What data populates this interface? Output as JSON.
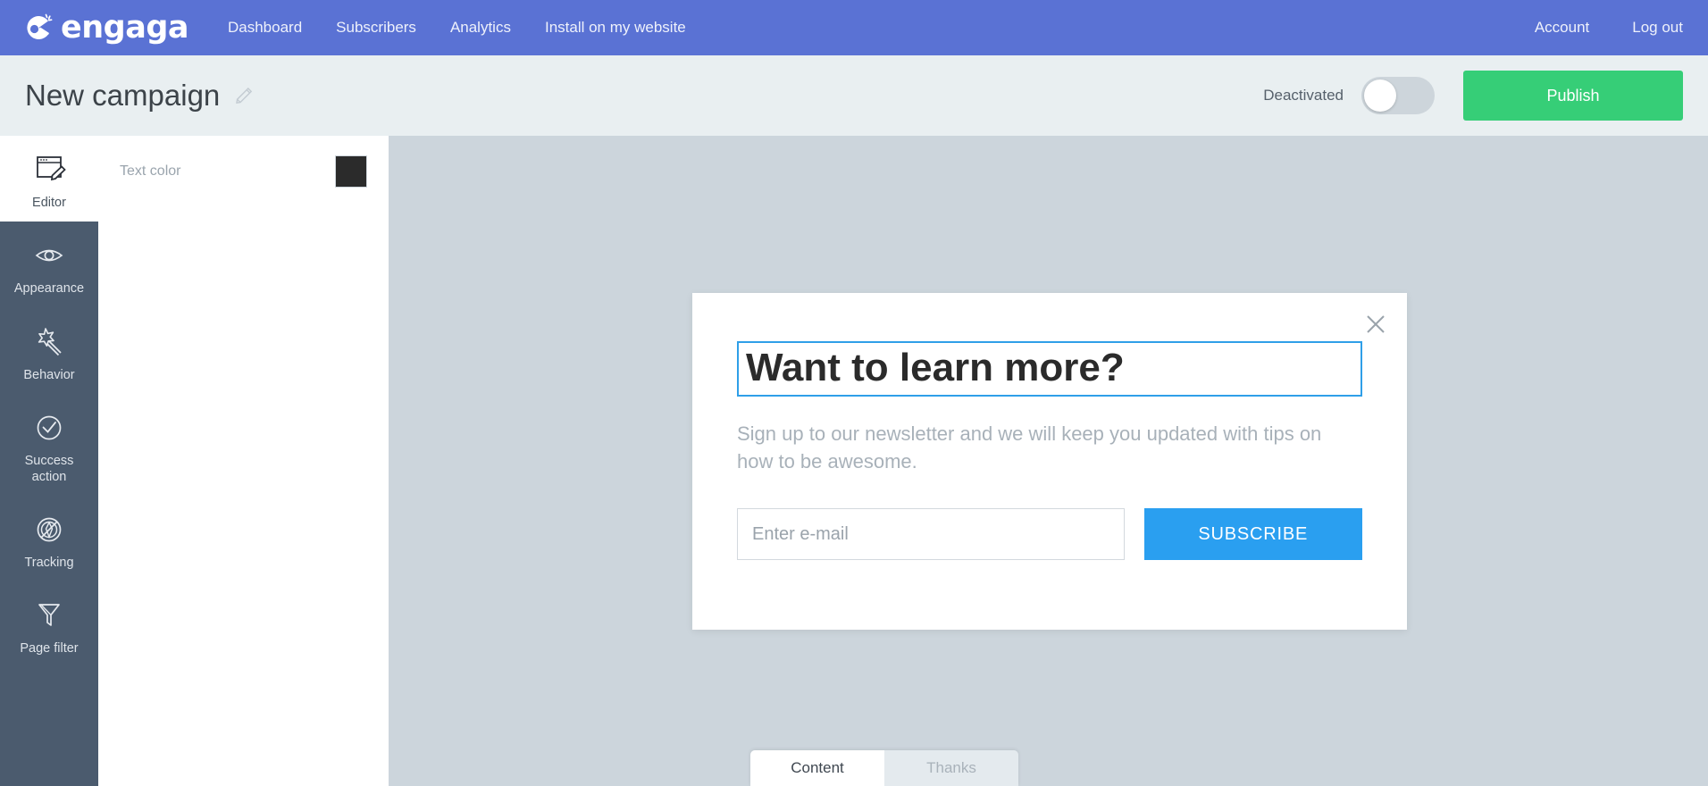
{
  "topnav": {
    "brand": "engaga",
    "brand_icon": "engaga-logo-icon",
    "links": [
      {
        "label": "Dashboard"
      },
      {
        "label": "Subscribers"
      },
      {
        "label": "Analytics"
      },
      {
        "label": "Install on my website"
      }
    ],
    "right_links": [
      {
        "label": "Account"
      },
      {
        "label": "Log out"
      }
    ],
    "bg_color": "#5a72d4"
  },
  "subheader": {
    "title": "New campaign",
    "edit_icon": "pencil-icon",
    "toggle_label": "Deactivated",
    "toggle_state": "off",
    "publish_label": "Publish",
    "publish_color": "#36ce77",
    "bg_color": "#e9eff1"
  },
  "sidebar": {
    "bg_color": "#4b5b6e",
    "items": [
      {
        "label": "Editor",
        "icon": "browser-pencil-icon",
        "active": true
      },
      {
        "label": "Appearance",
        "icon": "eye-icon",
        "active": false
      },
      {
        "label": "Behavior",
        "icon": "magic-wand-icon",
        "active": false
      },
      {
        "label": "Success\naction",
        "label_line1": "Success",
        "label_line2": "action",
        "icon": "check-circle-icon",
        "active": false
      },
      {
        "label": "Tracking",
        "icon": "tracking-circle-icon",
        "active": false
      },
      {
        "label": "Page filter",
        "icon": "funnel-icon",
        "active": false
      }
    ]
  },
  "panel": {
    "rows": [
      {
        "label": "Text color",
        "swatch_color": "#2b2b2b"
      }
    ]
  },
  "canvas": {
    "bg_color": "#ccd5dc"
  },
  "popup": {
    "close_icon": "close-icon",
    "headline": "Want to learn more?",
    "headline_selected": true,
    "headline_outline_color": "#2f9fe8",
    "subtext": "Sign up to our newsletter and we will keep you updated with tips on how to be awesome.",
    "email_placeholder": "Enter e-mail",
    "email_value": "",
    "subscribe_label": "SUBSCRIBE",
    "subscribe_color": "#2a9ff0"
  },
  "tabbar": {
    "tabs": [
      {
        "label": "Content",
        "active": true
      },
      {
        "label": "Thanks",
        "active": false
      }
    ]
  }
}
